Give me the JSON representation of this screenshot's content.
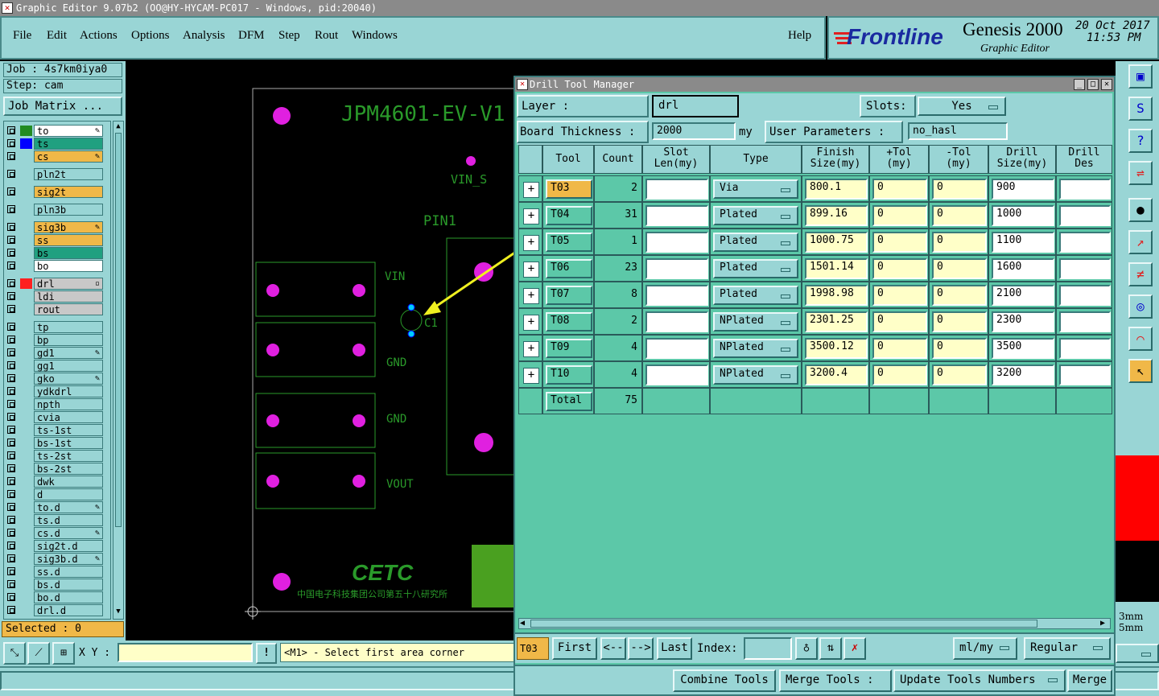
{
  "window": {
    "title": "Graphic Editor 9.07b2 (OO@HY-HYCAM-PC017 - Windows, pid:20040)"
  },
  "menu": {
    "items": [
      "File",
      "Edit",
      "Actions",
      "Options",
      "Analysis",
      "DFM",
      "Step",
      "Rout",
      "Windows"
    ],
    "help": "Help"
  },
  "brand": {
    "logo": "Frontline",
    "product": "Genesis 2000",
    "subtitle": "Graphic Editor",
    "date": "20 Oct 2017",
    "time": "11:53 PM"
  },
  "job": {
    "job_line": "Job : 4s7km0iya0",
    "step_line": "Step: cam",
    "job_matrix": "Job Matrix ..."
  },
  "layers": [
    {
      "name": "to",
      "swatch": "#228b22",
      "bg": "#ffffff",
      "flag": "✎"
    },
    {
      "name": "ts",
      "swatch": "#0000ff",
      "bg": "#20a080",
      "flag": ""
    },
    {
      "name": "cs",
      "swatch": "",
      "bg": "#f0b848",
      "flag": "✎"
    },
    {
      "name": "pln2t",
      "swatch": "",
      "bg": "#99d5d5",
      "flag": ""
    },
    {
      "name": "sig2t",
      "swatch": "",
      "bg": "#f0b848",
      "flag": ""
    },
    {
      "name": "pln3b",
      "swatch": "",
      "bg": "#99d5d5",
      "flag": ""
    },
    {
      "name": "sig3b",
      "swatch": "",
      "bg": "#f0b848",
      "flag": "✎"
    },
    {
      "name": "ss",
      "swatch": "",
      "bg": "#f0b848",
      "flag": ""
    },
    {
      "name": "bs",
      "swatch": "",
      "bg": "#20a080",
      "flag": ""
    },
    {
      "name": "bo",
      "swatch": "",
      "bg": "#ffffff",
      "flag": ""
    },
    {
      "name": "drl",
      "swatch": "#ff2020",
      "bg": "#c8c8c8",
      "flag": "▫"
    },
    {
      "name": "ldi",
      "swatch": "",
      "bg": "#c8c8c8",
      "flag": ""
    },
    {
      "name": "rout",
      "swatch": "",
      "bg": "#c8c8c8",
      "flag": ""
    },
    {
      "name": "tp",
      "swatch": "",
      "bg": "#99d5d5",
      "flag": ""
    },
    {
      "name": "bp",
      "swatch": "",
      "bg": "#99d5d5",
      "flag": ""
    },
    {
      "name": "gd1",
      "swatch": "",
      "bg": "#99d5d5",
      "flag": "✎"
    },
    {
      "name": "gg1",
      "swatch": "",
      "bg": "#99d5d5",
      "flag": ""
    },
    {
      "name": "gko",
      "swatch": "",
      "bg": "#99d5d5",
      "flag": "✎"
    },
    {
      "name": "ydkdrl",
      "swatch": "",
      "bg": "#99d5d5",
      "flag": ""
    },
    {
      "name": "npth",
      "swatch": "",
      "bg": "#99d5d5",
      "flag": ""
    },
    {
      "name": "cvia",
      "swatch": "",
      "bg": "#99d5d5",
      "flag": ""
    },
    {
      "name": "ts-1st",
      "swatch": "",
      "bg": "#99d5d5",
      "flag": ""
    },
    {
      "name": "bs-1st",
      "swatch": "",
      "bg": "#99d5d5",
      "flag": ""
    },
    {
      "name": "ts-2st",
      "swatch": "",
      "bg": "#99d5d5",
      "flag": ""
    },
    {
      "name": "bs-2st",
      "swatch": "",
      "bg": "#99d5d5",
      "flag": ""
    },
    {
      "name": "dwk",
      "swatch": "",
      "bg": "#99d5d5",
      "flag": ""
    },
    {
      "name": "d",
      "swatch": "",
      "bg": "#99d5d5",
      "flag": ""
    },
    {
      "name": "to.d",
      "swatch": "",
      "bg": "#99d5d5",
      "flag": "✎"
    },
    {
      "name": "ts.d",
      "swatch": "",
      "bg": "#99d5d5",
      "flag": ""
    },
    {
      "name": "cs.d",
      "swatch": "",
      "bg": "#99d5d5",
      "flag": "✎"
    },
    {
      "name": "sig2t.d",
      "swatch": "",
      "bg": "#99d5d5",
      "flag": ""
    },
    {
      "name": "sig3b.d",
      "swatch": "",
      "bg": "#99d5d5",
      "flag": "✎"
    },
    {
      "name": "ss.d",
      "swatch": "",
      "bg": "#99d5d5",
      "flag": ""
    },
    {
      "name": "bs.d",
      "swatch": "",
      "bg": "#99d5d5",
      "flag": ""
    },
    {
      "name": "bo.d",
      "swatch": "",
      "bg": "#99d5d5",
      "flag": ""
    },
    {
      "name": "drl.d",
      "swatch": "",
      "bg": "#99d5d5",
      "flag": ""
    }
  ],
  "status": {
    "selected": "Selected : 0",
    "xy_label": "X Y :",
    "prompt": "<M1> - Select first area corner"
  },
  "canvas": {
    "board_title": "JPM4601-EV-V1",
    "labels": {
      "vin_s": "VIN_S",
      "pin1": "PIN1",
      "vin": "VIN",
      "c1": "C1",
      "gnd1": "GND",
      "gnd2": "GND",
      "vout": "VOUT",
      "cetc": "CETC",
      "institute": "中国电子科技集团公司第五十八研究所"
    },
    "colors": {
      "pad": "#e020e0",
      "silk": "#2a9a2a",
      "arrow": "#f0f020"
    }
  },
  "dtm": {
    "title": "Drill Tool Manager",
    "layer_label": "Layer :",
    "layer_value": "drl",
    "slots_label": "Slots:",
    "slots_value": "Yes",
    "board_thickness_label": "Board Thickness :",
    "board_thickness_value": "2000",
    "board_thickness_unit": "my",
    "user_params_label": "User Parameters :",
    "user_params_value": "no_hasl",
    "columns": [
      "Tool",
      "Count",
      "Slot\nLen(my)",
      "Type",
      "Finish\nSize(my)",
      "+Tol\n(my)",
      "-Tol\n(my)",
      "Drill\nSize(my)",
      "Drill\nDes"
    ],
    "rows": [
      {
        "tool": "T03",
        "count": "2",
        "type": "Via",
        "finish": "800.1",
        "ptol": "0",
        "mtol": "0",
        "drill": "900"
      },
      {
        "tool": "T04",
        "count": "31",
        "type": "Plated",
        "finish": "899.16",
        "ptol": "0",
        "mtol": "0",
        "drill": "1000"
      },
      {
        "tool": "T05",
        "count": "1",
        "type": "Plated",
        "finish": "1000.75",
        "ptol": "0",
        "mtol": "0",
        "drill": "1100"
      },
      {
        "tool": "T06",
        "count": "23",
        "type": "Plated",
        "finish": "1501.14",
        "ptol": "0",
        "mtol": "0",
        "drill": "1600"
      },
      {
        "tool": "T07",
        "count": "8",
        "type": "Plated",
        "finish": "1998.98",
        "ptol": "0",
        "mtol": "0",
        "drill": "2100"
      },
      {
        "tool": "T08",
        "count": "2",
        "type": "NPlated",
        "finish": "2301.25",
        "ptol": "0",
        "mtol": "0",
        "drill": "2300"
      },
      {
        "tool": "T09",
        "count": "4",
        "type": "NPlated",
        "finish": "3500.12",
        "ptol": "0",
        "mtol": "0",
        "drill": "3500"
      },
      {
        "tool": "T10",
        "count": "4",
        "type": "NPlated",
        "finish": "3200.4",
        "ptol": "0",
        "mtol": "0",
        "drill": "3200"
      }
    ],
    "total_label": "Total",
    "total_count": "75",
    "nav": {
      "current": "T03",
      "first": "First",
      "prev": "<--",
      "next": "-->",
      "last": "Last",
      "index_label": "Index:",
      "units": "ml/my",
      "mode": "Regular"
    },
    "actions": {
      "combine": "Combine Tools",
      "merge_tools": "Merge Tools :",
      "update": "Update Tools Numbers",
      "merge": "Merge"
    }
  },
  "right": {
    "scale1": "3mm",
    "scale2": "5mm"
  }
}
